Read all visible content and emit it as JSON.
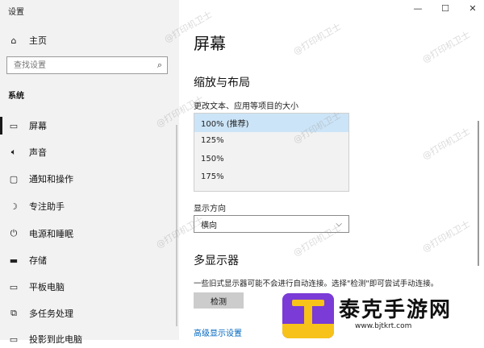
{
  "app_title": "设置",
  "window_controls": {
    "minimize": "—",
    "maximize": "☐",
    "close": "✕"
  },
  "sidebar": {
    "home": {
      "label": "主页",
      "icon": "home-icon"
    },
    "search_placeholder": "查找设置",
    "section": "系统",
    "items": [
      {
        "label": "屏幕",
        "icon": "monitor-icon"
      },
      {
        "label": "声音",
        "icon": "speaker-icon"
      },
      {
        "label": "通知和操作",
        "icon": "notification-icon"
      },
      {
        "label": "专注助手",
        "icon": "moon-icon"
      },
      {
        "label": "电源和睡眠",
        "icon": "power-icon"
      },
      {
        "label": "存储",
        "icon": "storage-icon"
      },
      {
        "label": "平板电脑",
        "icon": "tablet-icon"
      },
      {
        "label": "多任务处理",
        "icon": "multitask-icon"
      },
      {
        "label": "投影到此电脑",
        "icon": "project-icon"
      }
    ]
  },
  "main": {
    "title": "屏幕",
    "scale_section": "缩放与布局",
    "scale_label": "更改文本、应用等项目的大小",
    "scale_options": [
      "100% (推荐)",
      "125%",
      "150%",
      "175%"
    ],
    "orientation_label": "显示方向",
    "orientation_value": "横向",
    "multi_display_title": "多显示器",
    "multi_display_desc": "一些旧式显示器可能不会进行自动连接。选择\"检测\"即可尝试手动连接。",
    "detect_button": "检测",
    "advanced_link": "高级显示设置"
  },
  "watermark": "@打印机卫士",
  "logo": {
    "text": "泰克手游网",
    "url": "www.bjtkrt.com"
  }
}
